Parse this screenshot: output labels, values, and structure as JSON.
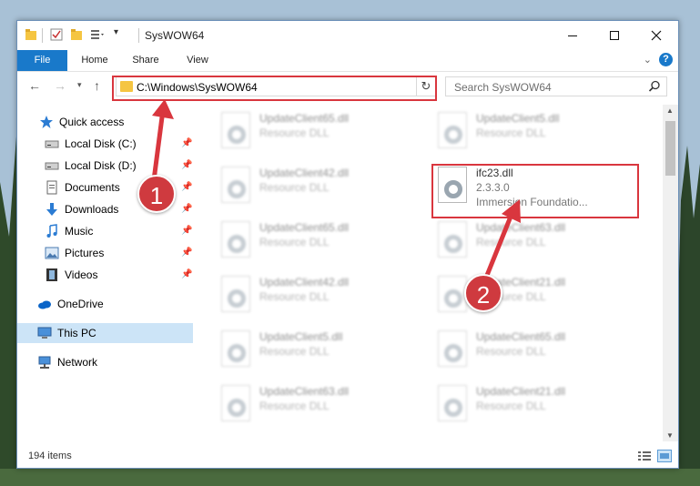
{
  "window": {
    "title": "SysWOW64"
  },
  "ribbon": {
    "tabs": [
      "File",
      "Home",
      "Share",
      "View"
    ],
    "help_label": "?"
  },
  "nav": {
    "address": "C:\\Windows\\SysWOW64",
    "search_placeholder": "Search SysWOW64"
  },
  "sidebar": {
    "items": [
      {
        "label": "Quick access",
        "icon": "star-icon"
      },
      {
        "label": "Local Disk (C:)",
        "icon": "drive-icon"
      },
      {
        "label": "Local Disk (D:)",
        "icon": "drive-icon"
      },
      {
        "label": "Documents",
        "icon": "document-icon"
      },
      {
        "label": "Downloads",
        "icon": "download-icon"
      },
      {
        "label": "Music",
        "icon": "music-icon"
      },
      {
        "label": "Pictures",
        "icon": "picture-icon"
      },
      {
        "label": "Videos",
        "icon": "video-icon"
      },
      {
        "label": "OneDrive",
        "icon": "cloud-icon"
      },
      {
        "label": "This PC",
        "icon": "computer-icon"
      },
      {
        "label": "Network",
        "icon": "network-icon"
      }
    ]
  },
  "files": {
    "left": [
      {
        "name": "UpdateClient65.dll",
        "type": "Resource DLL"
      },
      {
        "name": "UpdateClient42.dll",
        "type": "Resource DLL"
      },
      {
        "name": "UpdateClient65.dll",
        "type": "Resource DLL"
      },
      {
        "name": "UpdateClient42.dll",
        "type": "Resource DLL"
      },
      {
        "name": "UpdateClient5.dll",
        "type": "Resource DLL"
      },
      {
        "name": "UpdateClient63.dll",
        "type": "Resource DLL"
      }
    ],
    "right": [
      {
        "name": "UpdateClient5.dll",
        "type": "Resource DLL"
      },
      {
        "name": "ifc23.dll",
        "version": "2.3.3.0",
        "company": "Immersion Foundatio..."
      },
      {
        "name": "UpdateClient63.dll",
        "type": "Resource DLL"
      },
      {
        "name": "UpdateClient21.dll",
        "type": "Resource DLL"
      },
      {
        "name": "UpdateClient65.dll",
        "type": "Resource DLL"
      },
      {
        "name": "UpdateClient21.dll",
        "type": "Resource DLL"
      }
    ]
  },
  "status": {
    "item_count": "194 items"
  },
  "annotations": {
    "badge_1": "1",
    "badge_2": "2",
    "color": "#d9363e"
  }
}
